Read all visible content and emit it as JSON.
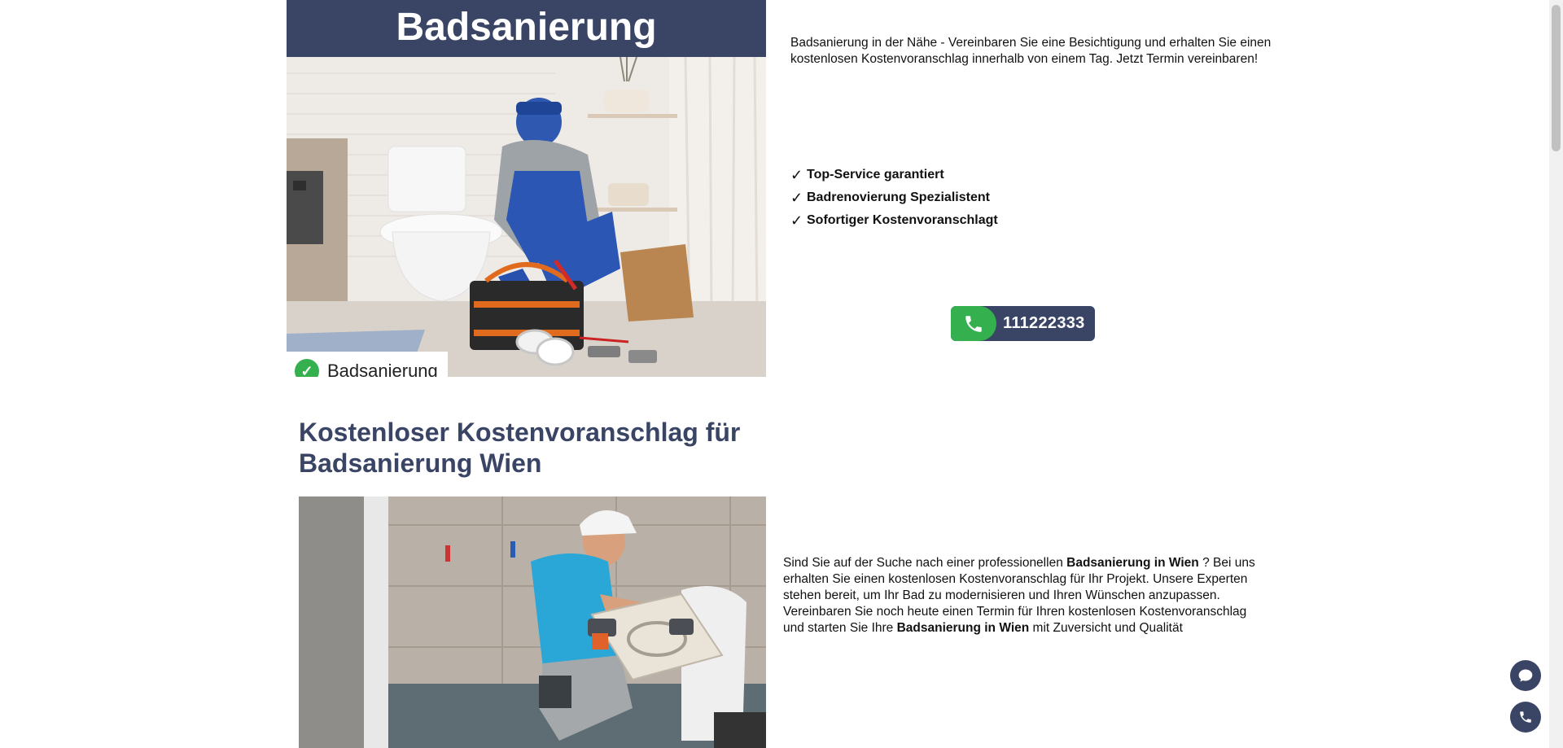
{
  "hero": {
    "title": "Badsanierung",
    "badge_label": "Badsanierung",
    "intro_text": "Badsanierung in der Nähe - Vereinbaren Sie eine Besichtigung und erhalten Sie einen kostenlosen Kostenvoranschlag innerhalb von einem Tag. Jetzt Termin vereinbaren!",
    "features": [
      {
        "check": "✓",
        "label": "Top-Service garantiert"
      },
      {
        "check": "✓",
        "label": "Badrenovierung Spezialistent"
      },
      {
        "check": "✓",
        "label": "Sofortiger Kostenvoranschlagt"
      }
    ],
    "phone_number": "111222333"
  },
  "section": {
    "title": "Kostenloser Kostenvoranschlag für Badsanierung Wien",
    "text_part1": "Sind Sie auf der Suche nach einer professionellen ",
    "text_bold1": "Badsanierung in Wien",
    "text_part2": " ? Bei uns erhalten Sie einen kostenlosen Kostenvoranschlag für Ihr Projekt. Unsere Experten stehen bereit, um Ihr Bad zu modernisieren und Ihren Wünschen anzupassen. Vereinbaren Sie noch heute einen Termin für Ihren kostenlosen Kostenvoranschlag und starten Sie Ihre ",
    "text_bold2": "Badsanierung in Wien",
    "text_part3": " mit Zuversicht und Qualität"
  },
  "icons": {
    "badge": "check-circle-icon",
    "call": "phone-icon",
    "fab_chat": "chat-bubble-icon",
    "fab_phone": "phone-icon"
  },
  "colors": {
    "brand_navy": "#3a4566",
    "accent_green": "#35b04f"
  }
}
